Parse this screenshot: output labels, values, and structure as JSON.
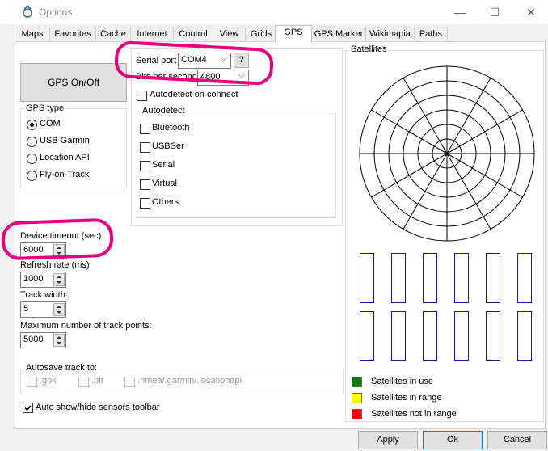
{
  "window": {
    "title": "Options",
    "minimize": "—",
    "maximize": "☐",
    "close": "✕"
  },
  "tabs": [
    "Maps",
    "Favorites",
    "Cache",
    "Internet",
    "Control",
    "View",
    "Grids",
    "GPS",
    "GPS Marker",
    "Wikimapia",
    "Paths"
  ],
  "active_tab": "GPS",
  "gps": {
    "on_off_label": "GPS On/Off",
    "gps_type": {
      "legend": "GPS type",
      "options": [
        "COM",
        "USB Garmin",
        "Location API",
        "Fly-on-Track"
      ],
      "selected": "COM"
    },
    "serial_port_label": "Serial port",
    "serial_port_value": "COM4",
    "serial_help": "?",
    "bps_label": "Bits per second",
    "bps_value": "4800",
    "autodetect_on_connect": "Autodetect on connect",
    "autodetect": {
      "legend": "Autodetect",
      "items": [
        "Bluetooth",
        "USBSer",
        "Serial",
        "Virtual",
        "Others"
      ]
    },
    "device_timeout_label": "Device timeout (sec)",
    "device_timeout_value": "6000",
    "refresh_rate_label": "Refresh rate (ms)",
    "refresh_rate_value": "1000",
    "track_width_label": "Track width:",
    "track_width_value": "5",
    "max_points_label": "Maximum number of track points:",
    "max_points_value": "5000",
    "autosave": {
      "legend": "Autosave track to:",
      "items": [
        ".gpx",
        ".plt",
        ".nmea/.garmin/.locationapi"
      ]
    },
    "auto_show_toolbar": "Auto show/hide sensors toolbar"
  },
  "satellites": {
    "legend": "Satellites",
    "legend_items": [
      {
        "label": "Satellites in use",
        "color": "#008000"
      },
      {
        "label": "Satellites in range",
        "color": "#ffff00"
      },
      {
        "label": "Satellites not in range",
        "color": "#ff0000"
      }
    ]
  },
  "footer": {
    "apply": "Apply",
    "ok": "Ok",
    "cancel": "Cancel"
  }
}
